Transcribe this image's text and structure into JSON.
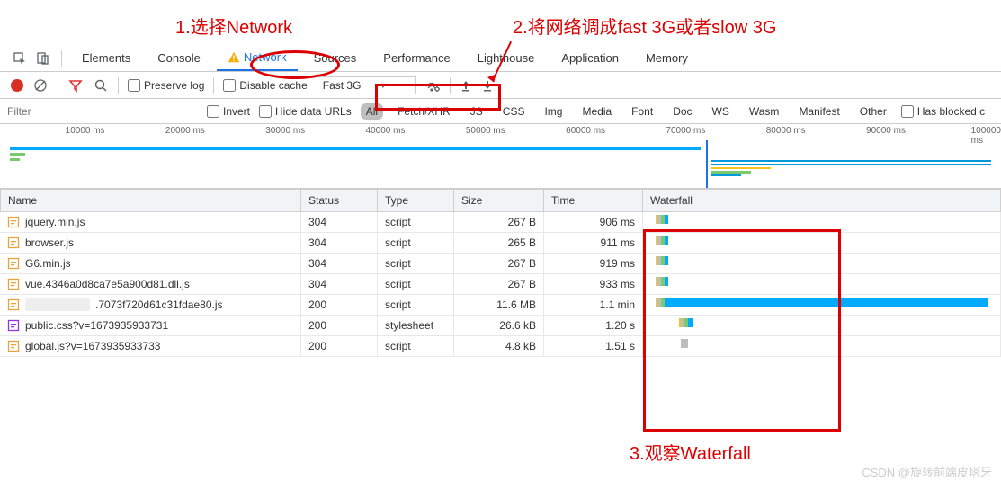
{
  "annotations": {
    "a1": "1.选择Network",
    "a2": "2.将网络调成fast 3G或者slow 3G",
    "a3": "3.观察Waterfall"
  },
  "tabs": {
    "elements": "Elements",
    "console": "Console",
    "network": "Network",
    "sources": "Sources",
    "performance": "Performance",
    "lighthouse": "Lighthouse",
    "application": "Application",
    "memory": "Memory"
  },
  "toolbar": {
    "preserve_log": "Preserve log",
    "disable_cache": "Disable cache",
    "throttle_value": "Fast 3G"
  },
  "filterbar": {
    "placeholder": "Filter",
    "invert": "Invert",
    "hide_data_urls": "Hide data URLs",
    "types": [
      "All",
      "Fetch/XHR",
      "JS",
      "CSS",
      "Img",
      "Media",
      "Font",
      "Doc",
      "WS",
      "Wasm",
      "Manifest",
      "Other"
    ],
    "has_blocked": "Has blocked c"
  },
  "overview": {
    "ticks": [
      "10000 ms",
      "20000 ms",
      "30000 ms",
      "40000 ms",
      "50000 ms",
      "60000 ms",
      "70000 ms",
      "80000 ms",
      "90000 ms",
      "100000 ms"
    ]
  },
  "table": {
    "headers": {
      "name": "Name",
      "status": "Status",
      "type": "Type",
      "size": "Size",
      "time": "Time",
      "waterfall": "Waterfall"
    },
    "rows": [
      {
        "icon": "js",
        "name": "jquery.min.js",
        "status": "304",
        "type": "script",
        "size": "267 B",
        "time": "906 ms",
        "wf": {
          "start": 16,
          "queue": 4,
          "wait": 4,
          "dl": 4
        }
      },
      {
        "icon": "js",
        "name": "browser.js",
        "status": "304",
        "type": "script",
        "size": "265 B",
        "time": "911 ms",
        "wf": {
          "start": 16,
          "queue": 4,
          "wait": 4,
          "dl": 4
        }
      },
      {
        "icon": "js",
        "name": "G6.min.js",
        "status": "304",
        "type": "script",
        "size": "267 B",
        "time": "919 ms",
        "wf": {
          "start": 16,
          "queue": 4,
          "wait": 4,
          "dl": 4
        }
      },
      {
        "icon": "js",
        "name": "vue.4346a0d8ca7e5a900d81.dll.js",
        "status": "304",
        "type": "script",
        "size": "267 B",
        "time": "933 ms",
        "wf": {
          "start": 16,
          "queue": 4,
          "wait": 4,
          "dl": 4
        }
      },
      {
        "icon": "js",
        "redacted": true,
        "name": ".7073f720d61c31fdae80.js",
        "status": "200",
        "type": "script",
        "size": "11.6 MB",
        "time": "1.1 min",
        "wf": {
          "start": 16,
          "queue": 4,
          "wait": 4,
          "dl": 360
        }
      },
      {
        "icon": "css",
        "name": "public.css?v=1673935933731",
        "status": "200",
        "type": "stylesheet",
        "size": "26.6 kB",
        "time": "1.20 s",
        "wf": {
          "start": 42,
          "queue": 4,
          "wait": 4,
          "dl": 6
        }
      },
      {
        "icon": "js",
        "name": "global.js?v=1673935933733",
        "status": "200",
        "type": "script",
        "size": "4.8 kB",
        "time": "1.51 s",
        "wf": {
          "start": 42,
          "queue": 8,
          "wait": 0,
          "dl": 0,
          "gray": true
        }
      }
    ]
  },
  "watermark": "CSDN @旋转前端皮塔牙"
}
